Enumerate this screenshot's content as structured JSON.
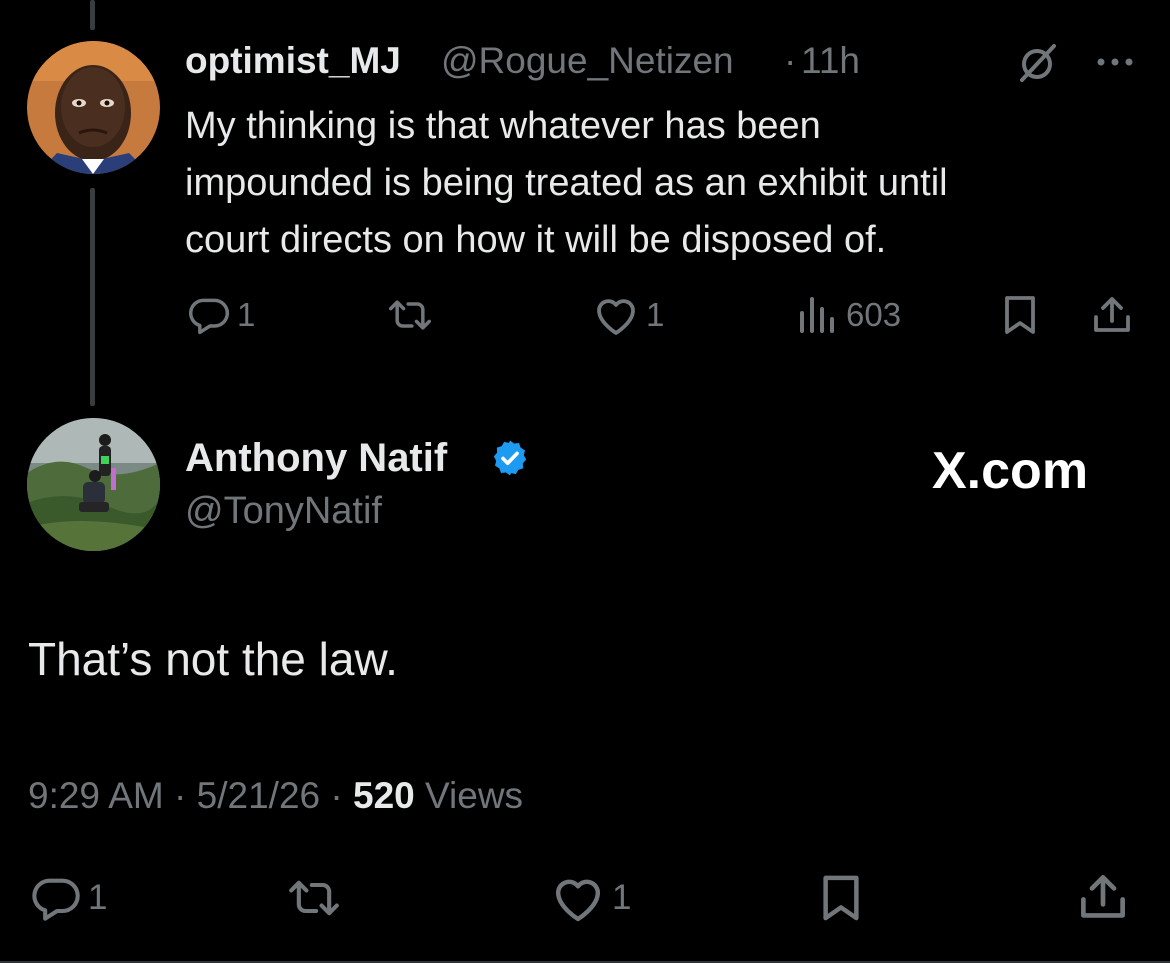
{
  "parent_tweet": {
    "display_name": "optimist_MJ",
    "handle": "@Rogue_Netizen",
    "separator": "·",
    "time": "11h",
    "text_lines": [
      "My thinking is that whatever has been",
      "impounded is being treated as an exhibit until",
      "court directs on how it will be disposed of."
    ],
    "reply_count": "1",
    "like_count": "1",
    "view_count": "603",
    "icons": [
      "grok-icon",
      "more-icon",
      "reply-icon",
      "retweet-icon",
      "like-icon",
      "views-icon",
      "bookmark-icon",
      "share-icon"
    ]
  },
  "main_tweet": {
    "display_name": "Anthony Natif",
    "handle": "@TonyNatif",
    "watermark": "X.com",
    "text": "That’s not the law.",
    "timestamp_time": "9:29 AM",
    "timestamp_sep1": " · ",
    "timestamp_date": "5/21/26",
    "timestamp_sep2": " · ",
    "views_count": "520",
    "views_label": "Views",
    "reply_count": "1",
    "like_count": "1",
    "icons": [
      "verified-badge-icon",
      "reply-icon",
      "retweet-icon",
      "like-icon",
      "bookmark-icon",
      "share-icon"
    ]
  },
  "colors": {
    "background": "#000000",
    "text": "#e7e9ea",
    "secondary": "#71767b",
    "verified": "#1d9bf0"
  }
}
